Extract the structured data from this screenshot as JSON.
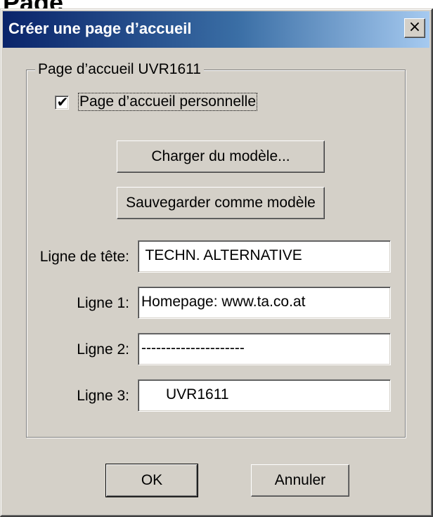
{
  "page_heading": "Page",
  "window": {
    "title": "Créer une page d’accueil",
    "close_label": "×"
  },
  "group": {
    "legend": "Page d’accueil UVR1611",
    "checkbox": {
      "label": "Page d’accueil personnelle",
      "checked": true,
      "mark": "✔"
    },
    "load_template_label": "Charger du modèle...",
    "save_template_label": "Sauvegarder comme modèle",
    "fields": [
      {
        "label": "Ligne de tête:",
        "value": " TECHN. ALTERNATIVE"
      },
      {
        "label": "Ligne 1:",
        "value": "Homepage: www.ta.co.at"
      },
      {
        "label": "Ligne 2:",
        "value": "---------------------"
      },
      {
        "label": "Ligne 3:",
        "value": "      UVR1611"
      }
    ]
  },
  "footer": {
    "ok_label": "OK",
    "cancel_label": "Annuler"
  }
}
